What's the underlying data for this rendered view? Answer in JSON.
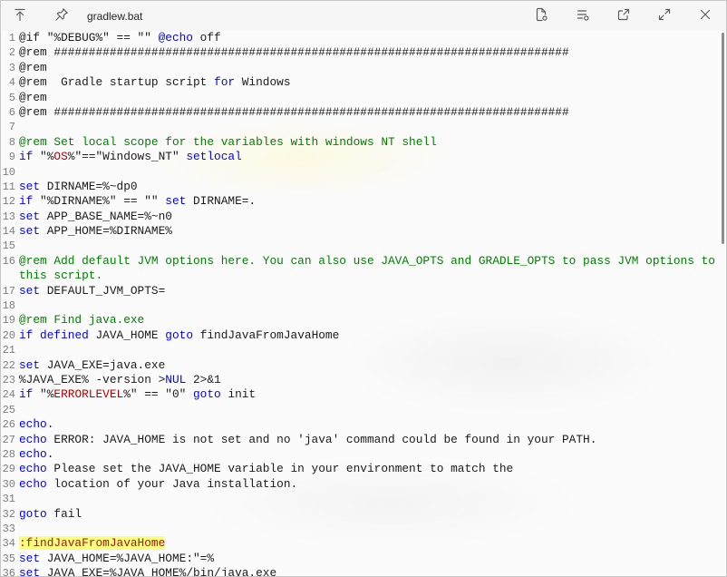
{
  "window": {
    "title": "gradlew.bat"
  },
  "toolbar": {
    "left_icons": [
      "arrow-up-to-line-icon",
      "pin-icon"
    ],
    "right_icons": [
      "open-file-icon",
      "list-options-icon",
      "share-icon",
      "expand-icon",
      "close-icon"
    ]
  },
  "colors": {
    "text": "#1b1b1b",
    "keyword": "#0000ff",
    "comment": "#008000",
    "sysvar": "#b40000",
    "label_bg": "#ffff7f",
    "label_fg": "#a31515",
    "line_number": "#7d7d7d",
    "icon": "#5a5a5a"
  },
  "editor": {
    "scroll": {
      "visible_fraction": 0.39,
      "position_fraction": 0
    }
  },
  "code": {
    "lines": [
      {
        "n": "1",
        "t": [
          [
            "text",
            "@if \"%DEBUG%\" == \"\" "
          ],
          [
            "keyword",
            "@echo"
          ],
          [
            "text",
            " off"
          ]
        ]
      },
      {
        "n": "2",
        "t": [
          [
            "text",
            "@rem ##########################################################################"
          ]
        ]
      },
      {
        "n": "3",
        "t": [
          [
            "text",
            "@rem"
          ]
        ]
      },
      {
        "n": "4",
        "t": [
          [
            "text",
            "@rem  Gradle startup script "
          ],
          [
            "keyword",
            "for"
          ],
          [
            "text",
            " Windows"
          ]
        ]
      },
      {
        "n": "5",
        "t": [
          [
            "text",
            "@rem"
          ]
        ]
      },
      {
        "n": "6",
        "t": [
          [
            "text",
            "@rem ##########################################################################"
          ]
        ]
      },
      {
        "n": "7",
        "t": []
      },
      {
        "n": "8",
        "t": [
          [
            "comment",
            "@rem Set local scope for the variables with windows NT shell"
          ]
        ]
      },
      {
        "n": "9",
        "t": [
          [
            "keyword",
            "if"
          ],
          [
            "text",
            " \"%"
          ],
          [
            "sysvar",
            "OS"
          ],
          [
            "text",
            "%\"==\"Windows_NT\" "
          ],
          [
            "keyword",
            "setlocal"
          ]
        ]
      },
      {
        "n": "10",
        "t": []
      },
      {
        "n": "11",
        "t": [
          [
            "keyword",
            "set"
          ],
          [
            "text",
            " DIRNAME=%~dp0"
          ]
        ]
      },
      {
        "n": "12",
        "t": [
          [
            "keyword",
            "if"
          ],
          [
            "text",
            " \"%DIRNAME%\" == \"\" "
          ],
          [
            "keyword",
            "set"
          ],
          [
            "text",
            " DIRNAME=."
          ]
        ]
      },
      {
        "n": "13",
        "t": [
          [
            "keyword",
            "set"
          ],
          [
            "text",
            " APP_BASE_NAME=%~n0"
          ]
        ]
      },
      {
        "n": "14",
        "t": [
          [
            "keyword",
            "set"
          ],
          [
            "text",
            " APP_HOME=%DIRNAME%"
          ]
        ]
      },
      {
        "n": "15",
        "t": []
      },
      {
        "n": "16",
        "t": [
          [
            "comment",
            "@rem Add default JVM options here. You can also use JAVA_OPTS and GRADLE_OPTS to pass JVM options to"
          ]
        ]
      },
      {
        "n": "",
        "t": [
          [
            "comment",
            "this script."
          ]
        ]
      },
      {
        "n": "17",
        "t": [
          [
            "keyword",
            "set"
          ],
          [
            "text",
            " DEFAULT_JVM_OPTS="
          ]
        ]
      },
      {
        "n": "18",
        "t": []
      },
      {
        "n": "19",
        "t": [
          [
            "comment",
            "@rem Find java.exe"
          ]
        ]
      },
      {
        "n": "20",
        "t": [
          [
            "keyword",
            "if"
          ],
          [
            "text",
            " "
          ],
          [
            "keyword",
            "defined"
          ],
          [
            "text",
            " JAVA_HOME "
          ],
          [
            "keyword",
            "goto"
          ],
          [
            "text",
            " findJavaFromJavaHome"
          ]
        ]
      },
      {
        "n": "21",
        "t": []
      },
      {
        "n": "22",
        "t": [
          [
            "keyword",
            "set"
          ],
          [
            "text",
            " JAVA_EXE=java.exe"
          ]
        ]
      },
      {
        "n": "23",
        "t": [
          [
            "text",
            "%JAVA_EXE% -version >"
          ],
          [
            "keyword",
            "NUL"
          ],
          [
            "text",
            " 2>&1"
          ]
        ]
      },
      {
        "n": "24",
        "t": [
          [
            "keyword",
            "if"
          ],
          [
            "text",
            " \"%"
          ],
          [
            "sysvar",
            "ERRORLEVEL"
          ],
          [
            "text",
            "%\" == \"0\" "
          ],
          [
            "keyword",
            "goto"
          ],
          [
            "text",
            " init"
          ]
        ]
      },
      {
        "n": "25",
        "t": []
      },
      {
        "n": "26",
        "t": [
          [
            "keyword",
            "echo"
          ],
          [
            "text",
            "."
          ]
        ]
      },
      {
        "n": "27",
        "t": [
          [
            "keyword",
            "echo"
          ],
          [
            "text",
            " ERROR: JAVA_HOME is not set and no 'java' command could be found in your PATH."
          ]
        ]
      },
      {
        "n": "28",
        "t": [
          [
            "keyword",
            "echo"
          ],
          [
            "text",
            "."
          ]
        ]
      },
      {
        "n": "29",
        "t": [
          [
            "keyword",
            "echo"
          ],
          [
            "text",
            " Please set the JAVA_HOME variable in your environment to match the"
          ]
        ]
      },
      {
        "n": "30",
        "t": [
          [
            "keyword",
            "echo"
          ],
          [
            "text",
            " location of your Java installation."
          ]
        ]
      },
      {
        "n": "31",
        "t": []
      },
      {
        "n": "32",
        "t": [
          [
            "keyword",
            "goto"
          ],
          [
            "text",
            " fail"
          ]
        ]
      },
      {
        "n": "33",
        "t": []
      },
      {
        "n": "34",
        "t": [
          [
            "label",
            ":findJavaFromJavaHome"
          ]
        ]
      },
      {
        "n": "35",
        "t": [
          [
            "keyword",
            "set"
          ],
          [
            "text",
            " JAVA_HOME=%JAVA_HOME:\"=%"
          ]
        ]
      },
      {
        "n": "36",
        "t": [
          [
            "keyword",
            "set"
          ],
          [
            "text",
            " JAVA_EXE=%JAVA_HOME%/bin/java.exe"
          ]
        ]
      }
    ]
  }
}
